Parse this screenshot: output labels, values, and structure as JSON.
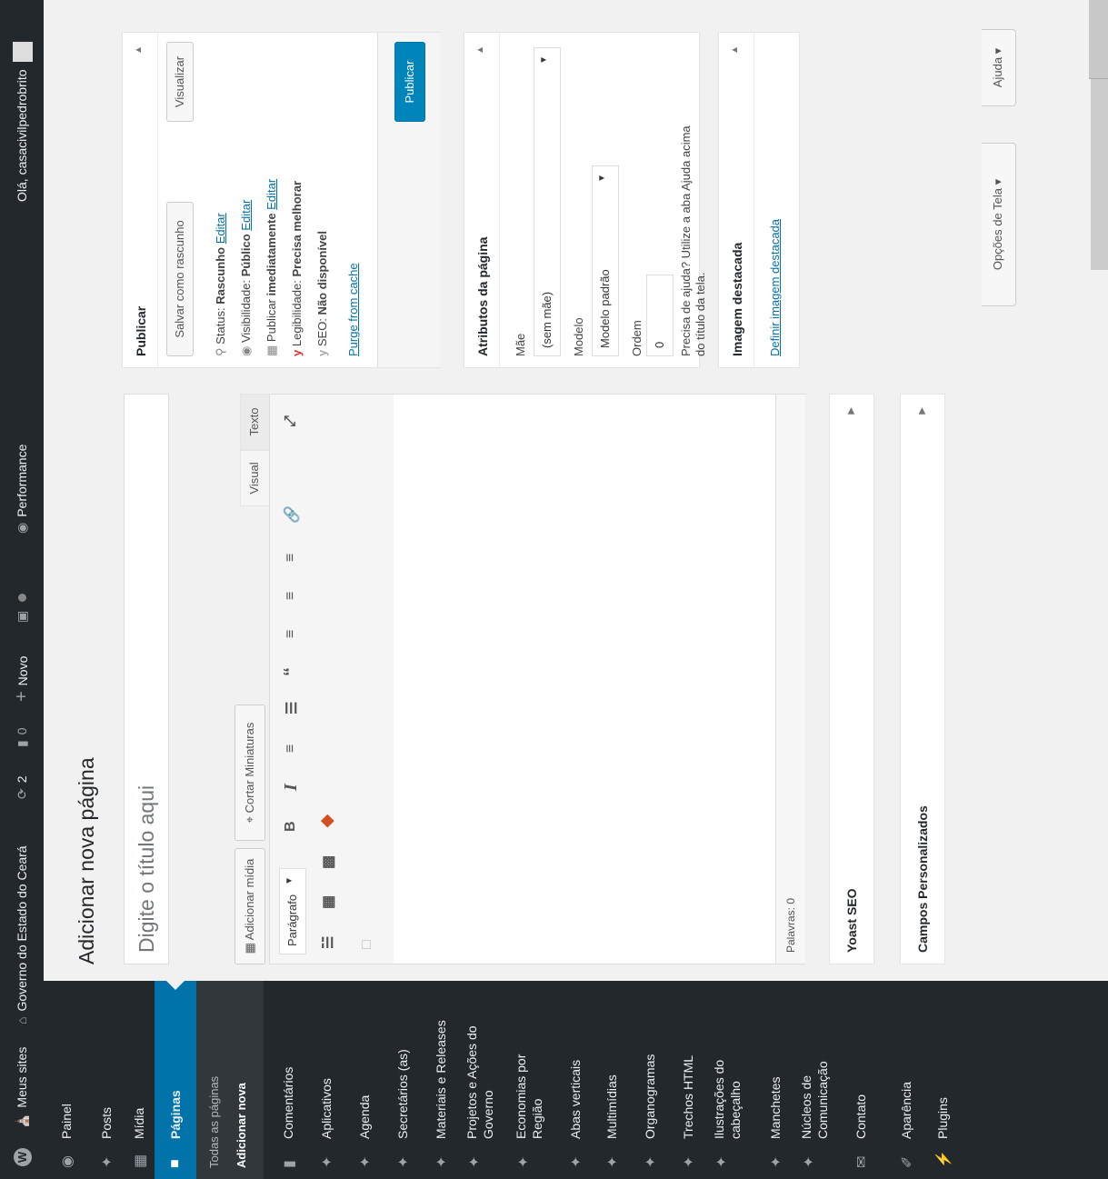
{
  "adminbar": {
    "wp_logo": "wordpress-logo",
    "meus_sites": "Meus sites",
    "site_name": "Governo do Estado do Ceará",
    "updates_count": "2",
    "comments_count": "0",
    "novo": "Novo",
    "performance": "Performance",
    "greeting": "Olá, casacivilpedrobrito"
  },
  "screen_meta": {
    "screen_options": "Opções de Tela",
    "help": "Ajuda"
  },
  "sidebar": {
    "painel": "Painel",
    "posts": "Posts",
    "midia": "Mídia",
    "paginas": "Páginas",
    "submenu": [
      "Todas as páginas",
      "Adicionar nova"
    ],
    "items": [
      "Comentários",
      "Aplicativos",
      "Agenda",
      "Secretários (as)",
      "Materiais e Releases",
      "Projetos e Ações do Governo",
      "Economias por Região",
      "Abas verticais",
      "Multimídias",
      "Organogramas",
      "Trechos HTML",
      "Ilustrações do cabeçalho",
      "Manchetes",
      "Núcleos de Comunicação",
      "Contato",
      "Aparência",
      "Plugins"
    ]
  },
  "page": {
    "heading": "Adicionar nova página",
    "title_placeholder": "Digite o título aqui"
  },
  "editor": {
    "add_media": "Adicionar mídia",
    "crop_thumbnails": "Cortar Miniaturas",
    "tab_visual": "Visual",
    "tab_text": "Texto",
    "format_select": "Parágrafo",
    "word_count": "Palavras: 0"
  },
  "metaboxes": {
    "yoast": "Yoast SEO",
    "custom_fields": "Campos Personalizados"
  },
  "publish": {
    "title": "Publicar",
    "save_draft": "Salvar como rascunho",
    "preview": "Visualizar",
    "status_label": "Status:",
    "status_value": "Rascunho",
    "visibility_label": "Visibilidade:",
    "visibility_value": "Público",
    "publish_label": "Publicar",
    "publish_value": "imediatamente",
    "edit": "Editar",
    "readability_label": "Legibilidade:",
    "readability_value": "Precisa melhorar",
    "seo_label": "SEO:",
    "seo_value": "Não disponível",
    "purge": "Purge from cache",
    "publish_button": "Publicar"
  },
  "attributes": {
    "title": "Atributos da página",
    "parent_label": "Mãe",
    "parent_value": "(sem mãe)",
    "template_label": "Modelo",
    "template_value": "Modelo padrão",
    "order_label": "Ordem",
    "order_value": "0",
    "help_line1": "Precisa de ajuda? Utilize a aba Ajuda acima",
    "help_line2": "do título da tela."
  },
  "featured": {
    "title": "Imagem destacada",
    "link": "Definir imagem destacada"
  },
  "colors": {
    "adminbar": "#23282d",
    "accent": "#0073aa",
    "yoast_red": "#dc3232"
  }
}
